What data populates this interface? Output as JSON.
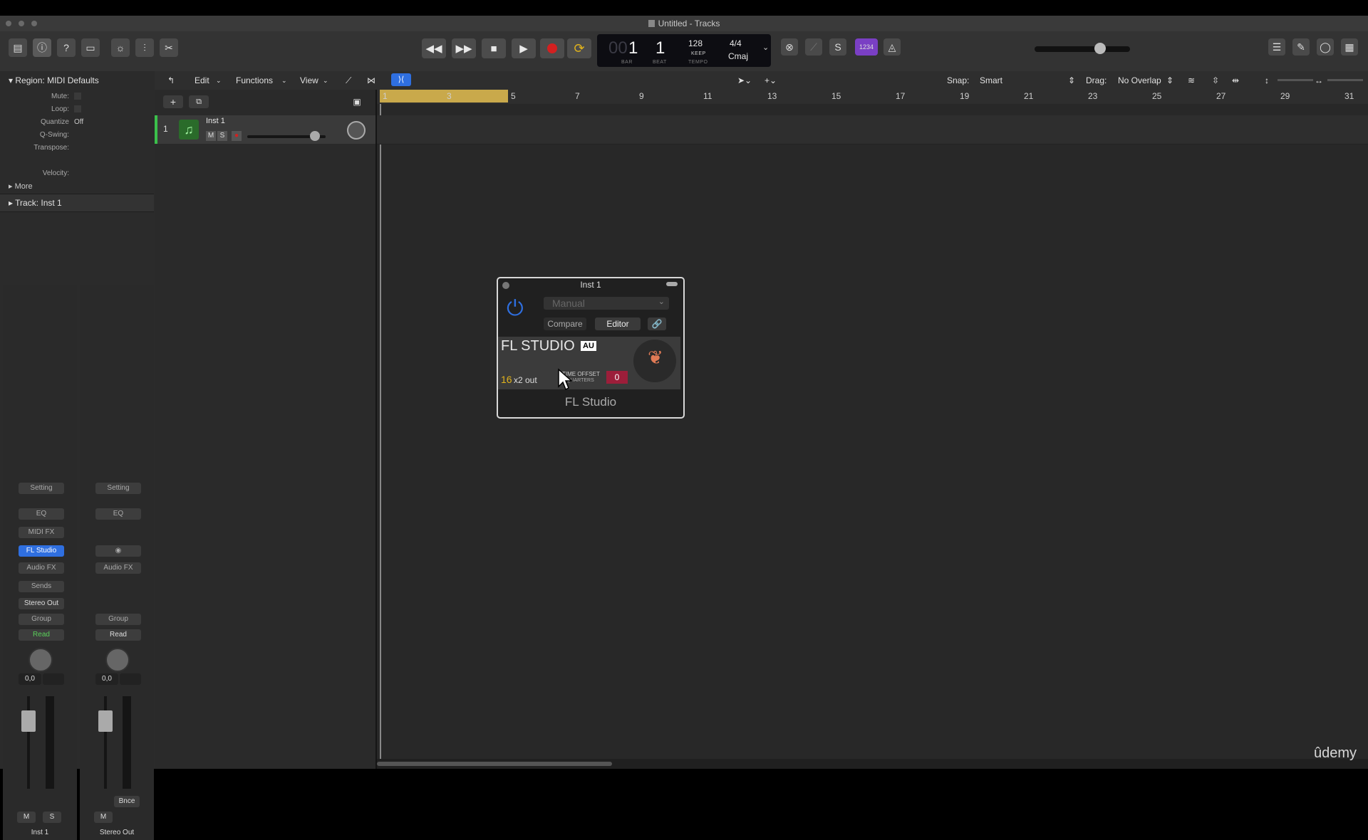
{
  "window": {
    "title": "Untitled - Tracks"
  },
  "lcd": {
    "bar_ghost": "00",
    "bar": "1",
    "beat": "1",
    "bar_label": "BAR",
    "beat_label": "BEAT",
    "tempo": "128",
    "tempo_mode": "KEEP",
    "tempo_label": "TEMPO",
    "time_signature": "4/4",
    "key": "Cmaj"
  },
  "toolbar": {
    "count_in_label": "1234"
  },
  "menus": {
    "edit": "Edit",
    "functions": "Functions",
    "view": "View"
  },
  "snap": {
    "label": "Snap:",
    "value": "Smart"
  },
  "drag": {
    "label": "Drag:",
    "value": "No Overlap"
  },
  "inspector": {
    "region_header": "Region:",
    "region_name": "MIDI Defaults",
    "fields": [
      {
        "label": "Mute:"
      },
      {
        "label": "Loop:"
      },
      {
        "label": "Quantize",
        "value": "Off"
      },
      {
        "label": "Q-Swing:"
      },
      {
        "label": "Transpose:"
      },
      {
        "label": "Velocity:"
      }
    ],
    "more": "More",
    "track_header": "Track:",
    "track_name": "Inst 1"
  },
  "strips": [
    {
      "setting": "Setting",
      "eq": "EQ",
      "midifx": "MIDI FX",
      "instrument": "FL Studio",
      "audiofx": "Audio FX",
      "sends": "Sends",
      "output": "Stereo Out",
      "group": "Group",
      "automation": "Read",
      "volume": "0,0",
      "mute": "M",
      "solo": "S",
      "name": "Inst 1"
    },
    {
      "setting": "Setting",
      "eq": "EQ",
      "audiofx": "Audio FX",
      "group": "Group",
      "automation": "Read",
      "volume": "0,0",
      "bounce": "Bnce",
      "mute": "M",
      "name": "Stereo Out"
    }
  ],
  "track": {
    "number": "1",
    "name": "Inst 1",
    "mute": "M",
    "solo": "S"
  },
  "ruler": [
    "1",
    "3",
    "5",
    "7",
    "9",
    "11",
    "13",
    "15",
    "17",
    "19",
    "21",
    "23",
    "25",
    "27",
    "29",
    "31"
  ],
  "plugin": {
    "title": "Inst 1",
    "preset": "Manual",
    "compare": "Compare",
    "editor": "Editor",
    "brand": "FL STUDIO",
    "au_badge": "AU",
    "outputs_num": "16",
    "outputs_text": "x2 out",
    "offset_line1": "TIME OFFSET",
    "offset_line2": "QUARTERS",
    "offset_value": "0",
    "footer": "FL Studio"
  },
  "watermark": "ûdemy",
  "colors": {
    "accent_blue": "#2f6fe0",
    "record_red": "#d32020",
    "cycle_yellow": "#e0b21c",
    "count_in_purple": "#7a3fc4",
    "region_yellow": "#c9a94b",
    "read_green": "#5ad05a"
  }
}
